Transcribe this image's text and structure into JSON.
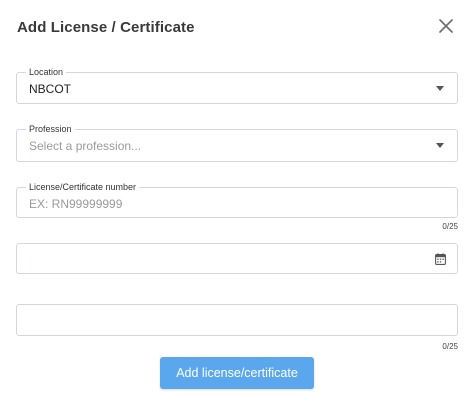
{
  "dialog": {
    "title": "Add License / Certificate",
    "close_icon": "close-icon"
  },
  "location": {
    "label": "Location",
    "value": "NBCOT",
    "icon": "caret-down-icon"
  },
  "profession": {
    "label": "Profession",
    "placeholder": "Select a profession...",
    "icon": "caret-down-icon"
  },
  "license_number": {
    "label": "License/Certificate number",
    "placeholder": "EX: RN99999999",
    "counter": "0/25"
  },
  "date": {
    "value": "",
    "icon": "calendar-icon"
  },
  "notes": {
    "value": "",
    "counter": "0/25"
  },
  "submit": {
    "label": "Add license/certificate",
    "color": "#5aa7ee"
  },
  "colors": {
    "border": "#d6d6e2",
    "title": "#3a3a3a",
    "placeholder": "#9a9a9a"
  }
}
